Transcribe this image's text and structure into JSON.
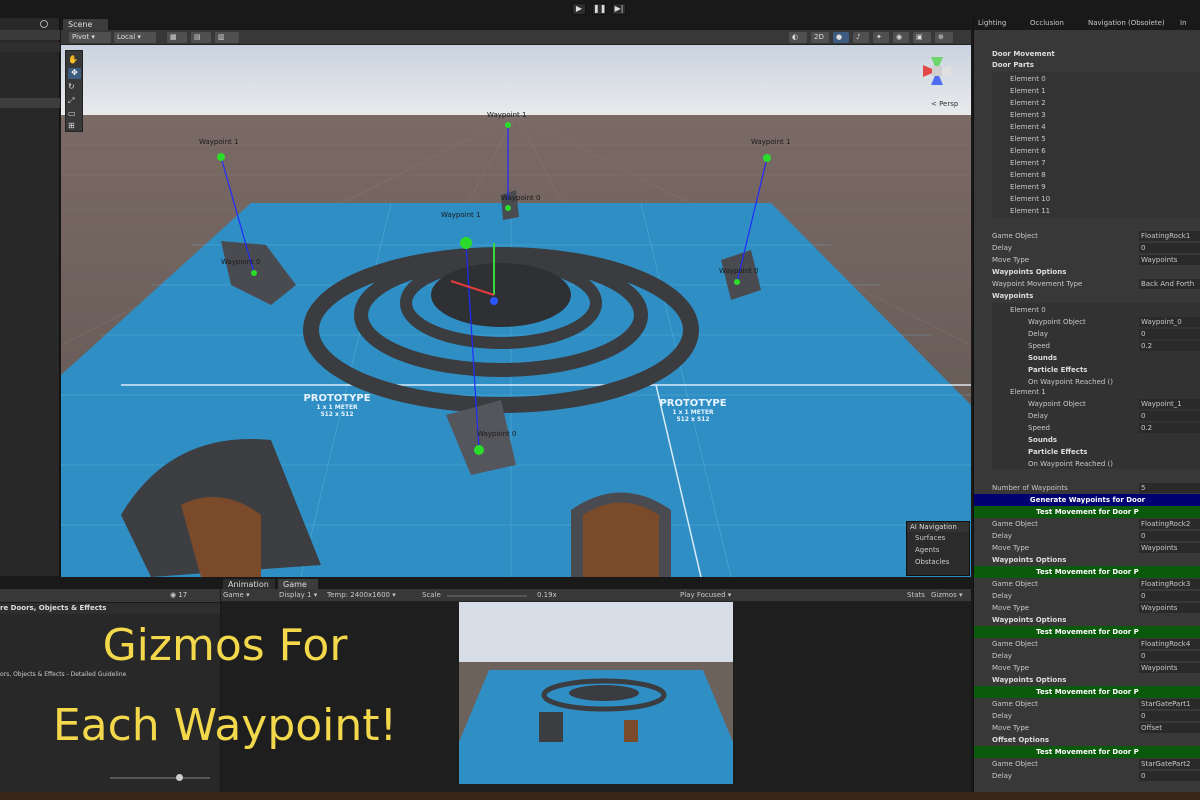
{
  "toolbar": {
    "play": "▶",
    "pause": "❚❚",
    "step": "▶|"
  },
  "scene": {
    "tab": "Scene",
    "pivot": "Pivot",
    "local": "Local",
    "mode2d": "2D",
    "persp": "< Persp",
    "labels": {
      "wp1_left": "Waypoint 1",
      "wp1_top": "Waypoint 1",
      "wp1_right": "Waypoint 1",
      "wp0_top": "Waypoint 0",
      "wp1_center": "Waypoint 1",
      "wp0_left": "Waypoint 0",
      "wp0_right": "Waypoint 0",
      "wp0_bottom": "Waypoint 0"
    },
    "prototype": {
      "title": "PROTOTYPE",
      "line1": "1 x 1 METER",
      "line2": "512 x 512"
    },
    "ai_nav": {
      "title": "AI Navigation",
      "items": [
        "Surfaces",
        "Agents",
        "Obstacles"
      ]
    }
  },
  "project": {
    "breadcrumb": "re Doors, Objects & Effects",
    "count": "17",
    "file": "ors, Objects & Effects - Detailed Guideline"
  },
  "game": {
    "tabs": [
      "Animation",
      "Game"
    ],
    "display_mode": "Game",
    "display": "Display 1",
    "resolution": "Temp: 2400x1600",
    "scale_label": "Scale",
    "scale_value": "0.19x",
    "play_focused": "Play Focused",
    "stats": "Stats",
    "gizmos": "Gizmos"
  },
  "overlay": {
    "line1": "Gizmos For",
    "line2": "Each Waypoint!"
  },
  "inspector": {
    "tabs": [
      "Lighting",
      "Occlusion",
      "Navigation (Obsolete)",
      "In"
    ],
    "component": "Door Movement",
    "door_parts": "Door Parts",
    "elements": [
      "Element 0",
      "Element 1",
      "Element 2",
      "Element 3",
      "Element 4",
      "Element 5",
      "Element 6",
      "Element 7",
      "Element 8",
      "Element 9",
      "Element 10",
      "Element 11"
    ],
    "game_object_label": "Game Object",
    "delay_label": "Delay",
    "move_type_label": "Move Type",
    "waypoints_options": "Waypoints Options",
    "wp_movement_type_label": "Waypoint Movement Type",
    "waypoints": "Waypoints",
    "waypoint_object_label": "Waypoint Object",
    "speed_label": "Speed",
    "sounds": "Sounds",
    "particle_effects": "Particle Effects",
    "on_reached": "On Waypoint Reached ()",
    "number_of_waypoints_label": "Number of Waypoints",
    "offset_options": "Offset Options",
    "fr1": {
      "go": "FloatingRock1",
      "delay": "0",
      "move_type": "Waypoints",
      "wp_movement": "Back And Forth"
    },
    "el0": {
      "label": "Element 0",
      "wp": "Waypoint_0",
      "delay": "0",
      "speed": "0.2"
    },
    "el1": {
      "label": "Element 1",
      "wp": "Waypoint_1",
      "delay": "0",
      "speed": "0.2"
    },
    "num_waypoints": "5",
    "generate_btn": "Generate Waypoints for Door",
    "test_btn": "Test Movement for Door P",
    "fr2": {
      "go": "FloatingRock2",
      "delay": "0",
      "move_type": "Waypoints"
    },
    "fr3": {
      "go": "FloatingRock3",
      "delay": "0",
      "move_type": "Waypoints"
    },
    "fr4": {
      "go": "FloatingRock4",
      "delay": "0",
      "move_type": "Waypoints"
    },
    "sg1": {
      "go": "StarGatePart1",
      "delay": "0",
      "move_type": "Offset"
    },
    "sg2": {
      "go": "StarGatePart2",
      "delay": "0"
    }
  }
}
